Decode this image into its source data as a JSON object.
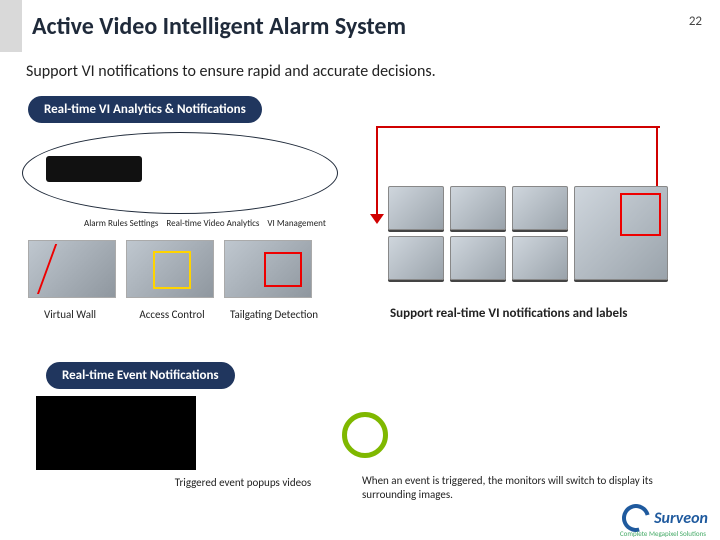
{
  "page_number": "22",
  "title": "Active Video Intelligent Alarm System",
  "subtitle": "Support VI notifications to ensure rapid and accurate decisions.",
  "pill_analytics": "Real-time VI Analytics & Notifications",
  "pill_events": "Real-time Event Notifications",
  "small_labels": {
    "a": "Alarm Rules Settings",
    "b": "Real-time Video Analytics",
    "c": "VI Management"
  },
  "thumbs": {
    "virtual_wall": "Virtual Wall",
    "access_control": "Access Control",
    "tailgating": "Tailgating Detection"
  },
  "right_caption": "Support real-time VI notifications and labels",
  "event_caption": "Triggered event popups videos",
  "event_right": "When an event is triggered, the monitors will switch to display its surrounding images.",
  "logo": {
    "brand": "Surveon",
    "tag": "Complete Megapixel Solutions"
  }
}
